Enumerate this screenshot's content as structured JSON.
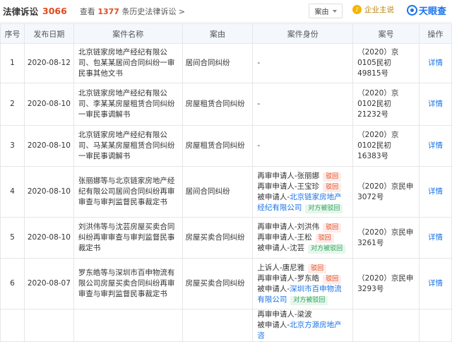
{
  "header": {
    "title": "法律诉讼",
    "count": "3066",
    "history_prefix": "查看",
    "history_num": "1377",
    "history_suffix": "条历史法律诉讼 >",
    "dropdown_label": "案由",
    "badge_label": "企业主说",
    "logo_text": "天眼查"
  },
  "table": {
    "headers": [
      "序号",
      "发布日期",
      "案件名称",
      "案由",
      "案件身份",
      "案号",
      "操作"
    ],
    "rows": [
      {
        "idx": "1",
        "date": "2020-08-12",
        "name": "北京链家房地产经纪有限公司、包某某居间合同纠纷一审民事其他文书",
        "reason": "居间合同纠纷",
        "identity": [
          {
            "text": "-"
          }
        ],
        "caseno": "（2020）京0105民初49815号",
        "op": "详情"
      },
      {
        "idx": "2",
        "date": "2020-08-10",
        "name": "北京链家房地产经纪有限公司、李某某房屋租赁合同纠纷一审民事调解书",
        "reason": "房屋租赁合同纠纷",
        "identity": [
          {
            "text": "-"
          }
        ],
        "caseno": "（2020）京0102民初21232号",
        "op": "详情"
      },
      {
        "idx": "3",
        "date": "2020-08-10",
        "name": "北京链家房地产经纪有限公司、马某某房屋租赁合同纠纷一审民事调解书",
        "reason": "房屋租赁合同纠纷",
        "identity": [
          {
            "text": "-"
          }
        ],
        "caseno": "（2020）京0102民初16383号",
        "op": "详情"
      },
      {
        "idx": "4",
        "date": "2020-08-10",
        "name": "张丽娜等与北京链家房地产经纪有限公司居间合同纠纷再审审查与审判监督民事裁定书",
        "reason": "居间合同纠纷",
        "identity": [
          {
            "role": "再审申请人-",
            "party": "张丽娜",
            "tag": "驳回",
            "tag_type": "red"
          },
          {
            "role": "再审申请人-",
            "party": "王宝珍",
            "tag": "驳回",
            "tag_type": "red"
          },
          {
            "role": "被申请人-",
            "party": "北京链家房地产经纪有限公司",
            "link": true,
            "tag": "对方被驳回",
            "tag_type": "green"
          }
        ],
        "caseno": "（2020）京民申3072号",
        "op": "详情"
      },
      {
        "idx": "5",
        "date": "2020-08-10",
        "name": "刘洪伟等与沈芸房屋买卖合同纠纷再审审查与审判监督民事裁定书",
        "reason": "房屋买卖合同纠纷",
        "identity": [
          {
            "role": "再审申请人-",
            "party": "刘洪伟",
            "tag": "驳回",
            "tag_type": "red"
          },
          {
            "role": "再审申请人-",
            "party": "王松",
            "tag": "驳回",
            "tag_type": "red"
          },
          {
            "role": "被申请人-",
            "party": "沈芸",
            "tag": "对方被驳回",
            "tag_type": "green"
          }
        ],
        "caseno": "（2020）京民申3261号",
        "op": "详情"
      },
      {
        "idx": "6",
        "date": "2020-08-07",
        "name": "罗东皓等与深圳市百申物流有限公司房屋买卖合同纠纷再审审查与审判监督民事裁定书",
        "reason": "房屋买卖合同纠纷",
        "identity": [
          {
            "role": "上诉人-",
            "party": "唐尼雅",
            "tag": "驳回",
            "tag_type": "red"
          },
          {
            "role": "再审申请人-",
            "party": "罗东皓",
            "tag": "驳回",
            "tag_type": "red"
          },
          {
            "role": "被申请人-",
            "party": "深圳市百申物流有限公司",
            "link": true,
            "tag": "对方被驳回",
            "tag_type": "green"
          }
        ],
        "caseno": "（2020）京民申3293号",
        "op": "详情"
      },
      {
        "idx": "",
        "date": "",
        "name": "",
        "reason": "",
        "identity": [
          {
            "role": "再审申请人-",
            "party": "梁波"
          },
          {
            "role": "被申请人-",
            "party": "北京方源房地产咨",
            "link": true
          }
        ],
        "caseno": "",
        "op": ""
      }
    ]
  }
}
